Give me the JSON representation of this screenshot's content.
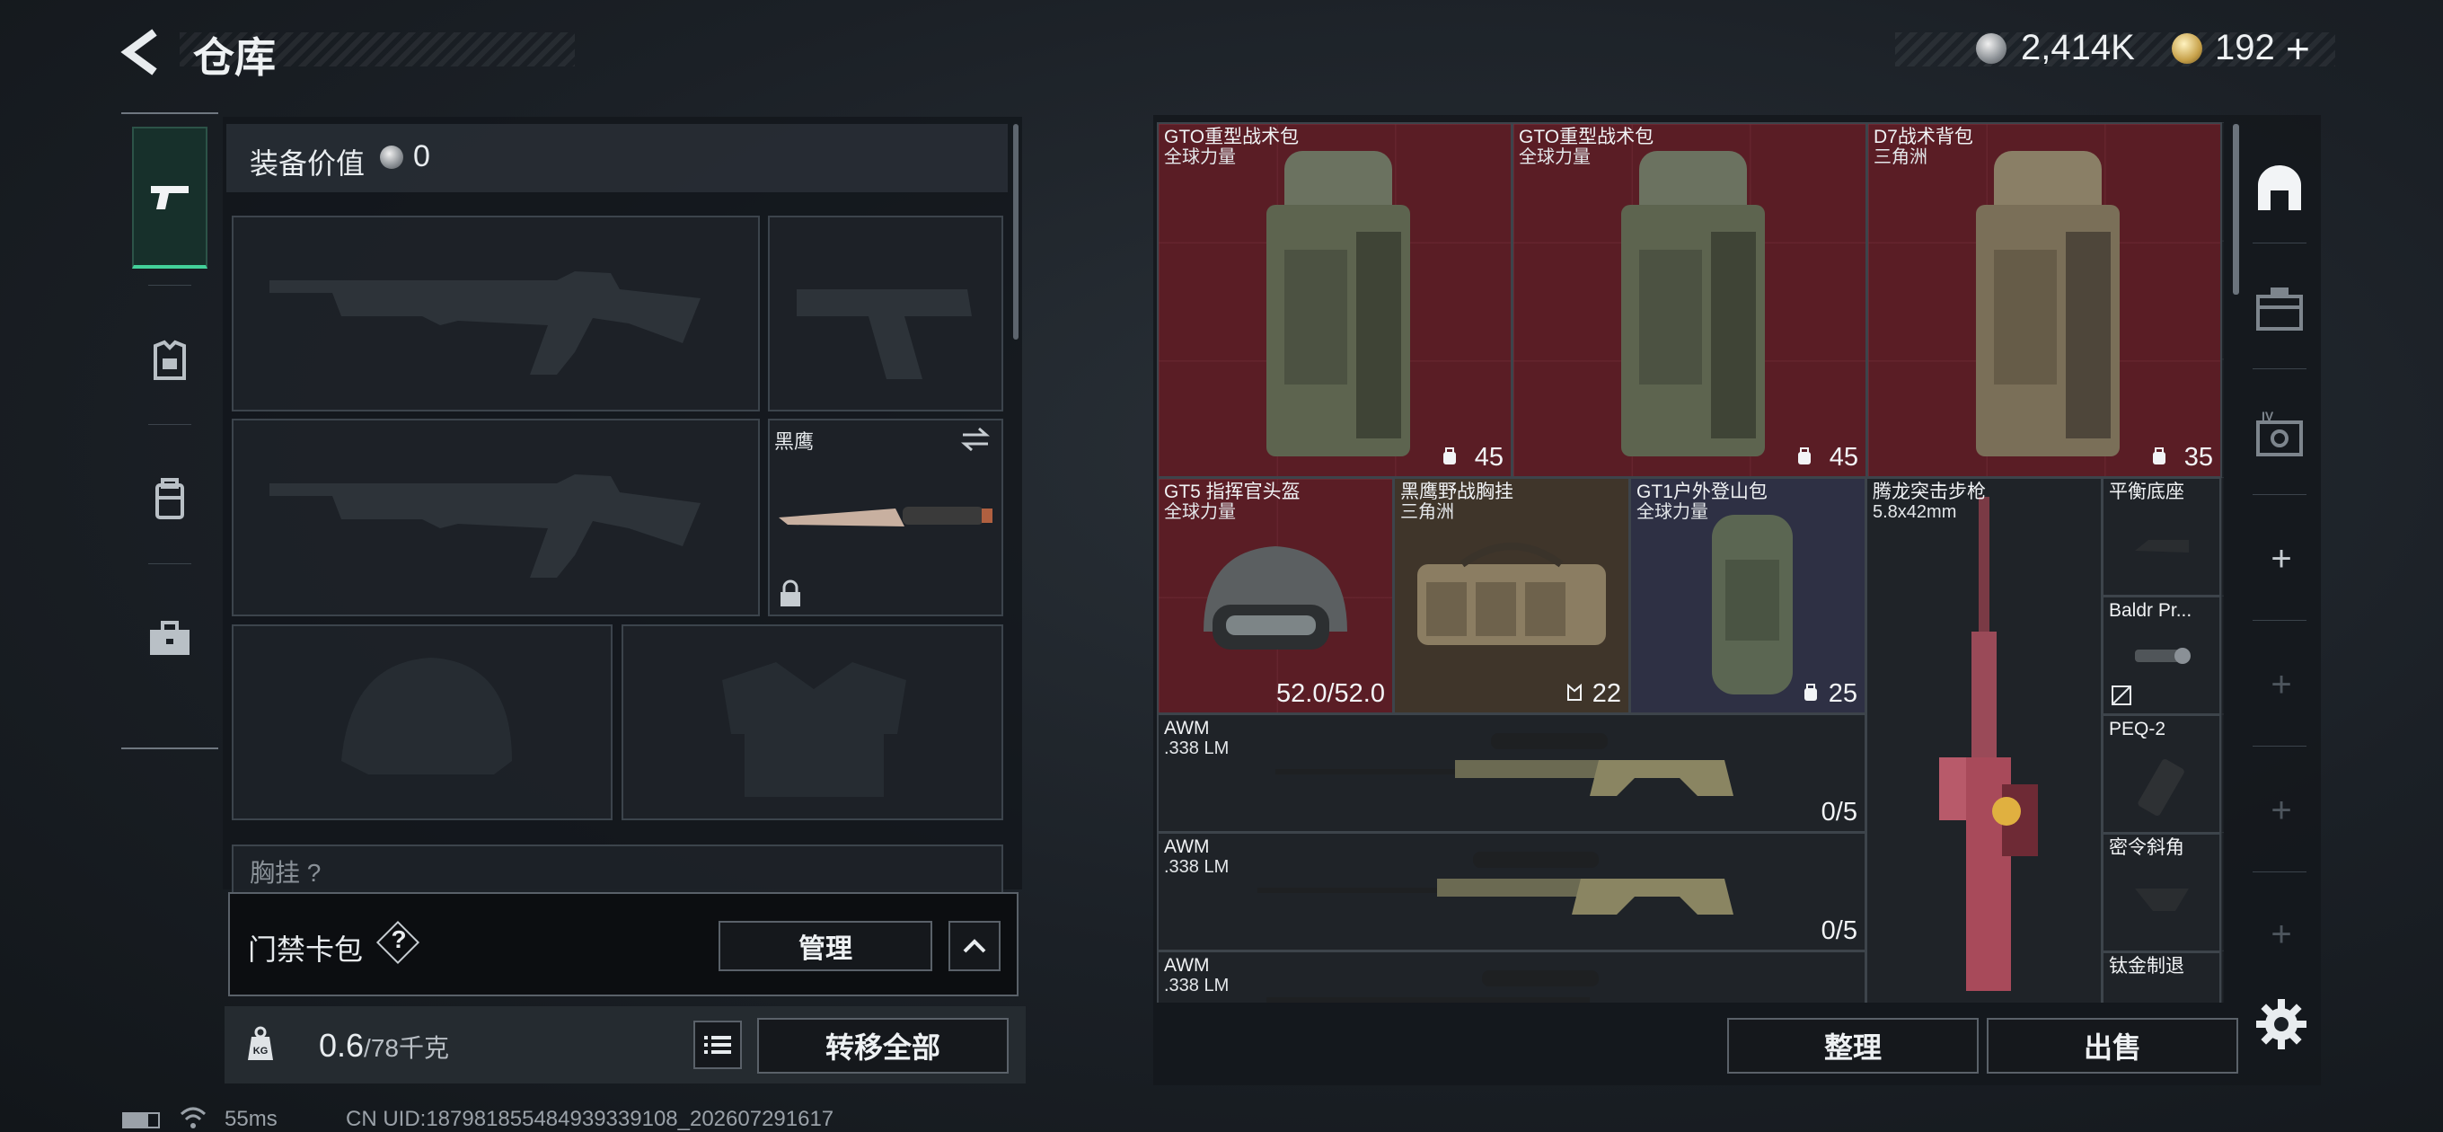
{
  "header": {
    "title": "仓库",
    "currency1": "2,414K",
    "currency2": "192",
    "plus": "+"
  },
  "icons": {
    "back": "back-arrow-icon",
    "pistol": "pistol-icon",
    "armor": "armor-icon",
    "backpack": "backpack-icon",
    "toolbox": "toolbox-icon",
    "lock": "lock-icon",
    "swap": "swap-icon",
    "weight": "weight-icon",
    "list": "list-icon",
    "chevron_up": "chevron-up-icon",
    "gear": "gear-icon"
  },
  "loadout": {
    "equipment_value_label": "装备价值",
    "equipment_value": "0",
    "knife_label": "黑鹰",
    "chest_label": "胸挂",
    "chest_help": "?"
  },
  "access_card": {
    "label": "门禁卡包",
    "help": "?",
    "manage": "管理"
  },
  "weight": {
    "current": "0.6",
    "max": "/78千克"
  },
  "transfer_all": "转移全部",
  "status": {
    "ping": "55ms",
    "uid": "CN UID:187981855484939339108_202607291617"
  },
  "warehouse": {
    "items": [
      {
        "name": "GTO重型战术包",
        "sub": "全球力量",
        "count": "45"
      },
      {
        "name": "GTO重型战术包",
        "sub": "全球力量",
        "count": "45"
      },
      {
        "name": "D7战术背包",
        "sub": "三角洲",
        "count": "35"
      },
      {
        "name": "GT5 指挥官头盔",
        "sub": "全球力量",
        "count": "52.0/52.0"
      },
      {
        "name": "黑鹰野战胸挂",
        "sub": "三角洲",
        "count": "22"
      },
      {
        "name": "GT1户外登山包",
        "sub": "全球力量",
        "count": "25"
      },
      {
        "name": "腾龙突击步枪",
        "sub": "5.8x42mm",
        "count": ""
      },
      {
        "name": "平衡底座",
        "sub": "",
        "count": ""
      },
      {
        "name": "Baldr Pr...",
        "sub": "",
        "count": ""
      },
      {
        "name": "PEQ-2",
        "sub": "",
        "count": ""
      },
      {
        "name": "密令斜角",
        "sub": "",
        "count": ""
      },
      {
        "name": "钛金制退",
        "sub": "",
        "count": ""
      },
      {
        "name": "AWM",
        "sub": ".338 LM",
        "count": "0/5"
      },
      {
        "name": "AWM",
        "sub": ".338 LM",
        "count": "0/5"
      },
      {
        "name": "AWM",
        "sub": ".338 LM",
        "count": ""
      }
    ],
    "sort": "整理",
    "sell": "出售",
    "plus": "+"
  },
  "colors": {
    "accent": "#43d19a",
    "rarity_red": "#5a1d25",
    "rarity_purple": "#2e3044",
    "rarity_brown": "#3f352a"
  }
}
